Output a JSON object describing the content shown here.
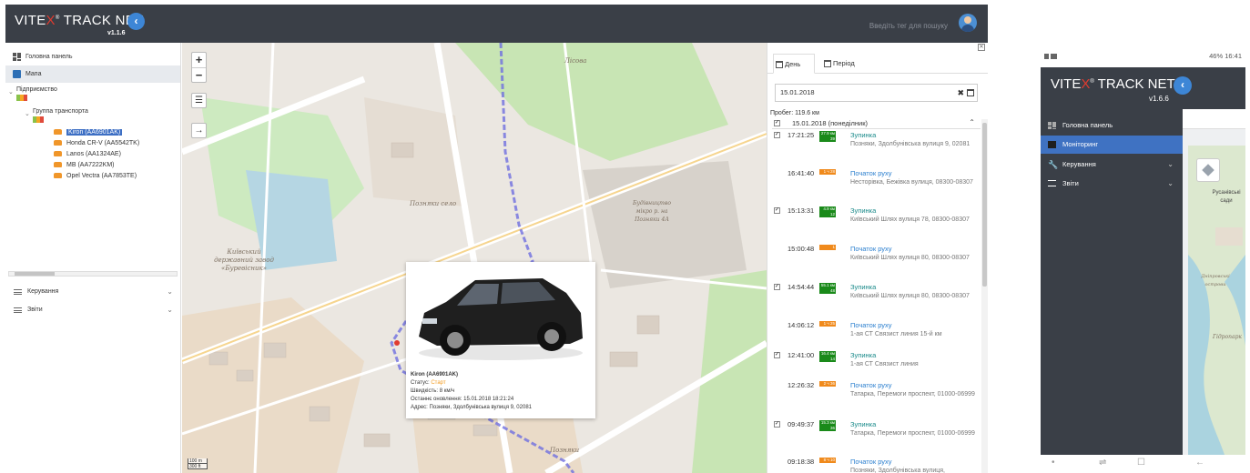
{
  "desktop": {
    "brand": {
      "prefix": "VITE",
      "x": "X",
      "reg": "®",
      "suffix": " TRACK NET",
      "version": "v1.1.6"
    },
    "back_label": "‹",
    "search_placeholder": "Введіть тег для пошуку",
    "sidebar": {
      "nav": [
        {
          "label": "Головна панель",
          "icon": "dashboard-icon"
        },
        {
          "label": "Мапа",
          "icon": "map-icon"
        }
      ],
      "enterprise": {
        "label": "Підприємство",
        "badges": [
          "5",
          "2",
          "0"
        ]
      },
      "group": {
        "label": "Группа транспорта",
        "badges": [
          "3",
          "2",
          "0"
        ]
      },
      "vehicles": [
        "Kiron (AA6901AK)",
        "Honda CR-V (AA5542TK)",
        "Lanos (AA1324AE)",
        "MB (AA7222KM)",
        "Opel Vectra (AA7853TE)"
      ],
      "menu": [
        {
          "label": "Керування"
        },
        {
          "label": "Звіти"
        }
      ]
    },
    "map": {
      "labels": [
        "Позняки село",
        "Київський державний завод «Буревісник»",
        "Будівництво мікро р. на Позняки 4А",
        "Позняки",
        "Лісова"
      ],
      "scale": [
        "100 m",
        "300 ft"
      ]
    },
    "popup": {
      "name": "Kiron (AA6901AK)",
      "status_label": "Статус: ",
      "status": "Старт",
      "speed": "Швидкість: 8 км/ч",
      "updated": "Останнє оновлення: 15.01.2018 18:21:24",
      "address": "Адрес: Позняки, Здолбунівська вулиця 9, 02081"
    },
    "panel": {
      "close": "✕",
      "tabs": [
        "День",
        "Період"
      ],
      "date": "15.01.2018",
      "mileage": "Пробег: 119.6 км",
      "day": "15.01.2018 (понеділник)",
      "events": [
        {
          "time": "17:21:25",
          "tag": "27.9 км",
          "sub": "39",
          "color": "g",
          "title": "Зупинка",
          "kind": "stop",
          "addr": "Позняки, Здолбунівська вулиця 9, 02081",
          "checked": true
        },
        {
          "time": "16:41:40",
          "tag": "1 ч 28",
          "sub": "",
          "color": "o",
          "title": "Початок руху",
          "kind": "move",
          "addr": "Несторівка, Бежівка вулиця, 08300-08307",
          "checked": false
        },
        {
          "time": "15:13:31",
          "tag": "4.9 км",
          "sub": "12",
          "color": "g",
          "title": "Зупинка",
          "kind": "stop",
          "addr": "Київський Шлях вулиця 78, 08300-08307",
          "checked": true
        },
        {
          "time": "15:00:48",
          "tag": "1",
          "sub": "",
          "color": "o",
          "title": "Початок руху",
          "kind": "move",
          "addr": "Київський Шлях вулиця 80, 08300-08307",
          "checked": false
        },
        {
          "time": "14:54:44",
          "tag": "55.1 км",
          "sub": "48",
          "color": "g",
          "title": "Зупинка",
          "kind": "stop",
          "addr": "Київський Шлях вулиця 80, 08300-08307",
          "checked": true
        },
        {
          "time": "14:06:12",
          "tag": "1 ч 25",
          "sub": "",
          "color": "o",
          "title": "Початок руху",
          "kind": "move",
          "addr": "1-ая СТ Связист линия 15-й км",
          "checked": false
        },
        {
          "time": "12:41:00",
          "tag": "16.4 км",
          "sub": "14",
          "color": "g",
          "title": "Зупинка",
          "kind": "stop",
          "addr": "1-ая СТ Связист линия",
          "checked": true
        },
        {
          "time": "12:26:32",
          "tag": "2 ч 36",
          "sub": "",
          "color": "o",
          "title": "Початок руху",
          "kind": "move",
          "addr": "Татарка, Перемоги проспект, 01000-06999",
          "checked": false
        },
        {
          "time": "09:49:37",
          "tag": "15.3 км",
          "sub": "36",
          "color": "g",
          "title": "Зупинка",
          "kind": "stop",
          "addr": "Татарка, Перемоги проспект, 01000-06999",
          "checked": true
        },
        {
          "time": "09:18:38",
          "tag": "8 ч 10",
          "sub": "",
          "color": "o",
          "title": "Початок руху",
          "kind": "move",
          "addr": "Позняки, Здолбунівська вулиця,",
          "checked": false
        }
      ]
    }
  },
  "phone": {
    "status_right": "46% 16:41",
    "brand": {
      "prefix": "VITE",
      "x": "X",
      "reg": "®",
      "suffix": " TRACK NET",
      "version": "v1.6.6"
    },
    "menu": [
      {
        "label": "Головна панель",
        "active": false,
        "arrow": ""
      },
      {
        "label": "Моніторинг",
        "active": true,
        "arrow": ""
      },
      {
        "label": "Керування",
        "active": false,
        "arrow": "⌄"
      },
      {
        "label": "Звіти",
        "active": false,
        "arrow": "⌄"
      }
    ],
    "map_labels": [
      "Русанівські сади",
      "Дніпровські острови",
      "Гідропарк"
    ]
  },
  "colors": {
    "header": "#3a3f47",
    "accent": "#3d86d6",
    "active": "#3f72c2",
    "stop": "#1a8a1a",
    "move": "#f08a1c"
  }
}
